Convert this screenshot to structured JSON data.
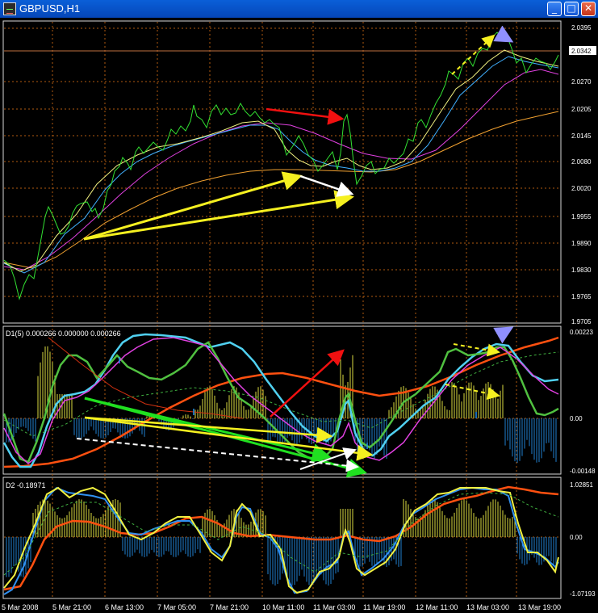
{
  "window": {
    "title": "GBPUSD,H1",
    "buttons": [
      "_",
      "□",
      "✕"
    ]
  },
  "price_scale": [
    "2.0395",
    "2.0342",
    "2.0270",
    "2.0205",
    "2.0145",
    "2.0080",
    "2.0020",
    "1.9955",
    "1.9890",
    "1.9830",
    "1.9765",
    "1.9705"
  ],
  "current_price": "2.0342",
  "panel1": {
    "label": "D1(5) 0.000266 0.000000 0.000266",
    "scale": [
      "0.00223",
      "0.00",
      "-0.00148"
    ]
  },
  "panel2": {
    "label": "D2 -0.18971",
    "scale": [
      "1.02851",
      "0.00",
      "-1.07193"
    ]
  },
  "time_axis": [
    "5 Mar 2008",
    "5 Mar 21:00",
    "6 Mar 13:00",
    "7 Mar 05:00",
    "7 Mar 21:00",
    "10 Mar 11:00",
    "11 Mar 03:00",
    "11 Mar 19:00",
    "12 Mar 11:00",
    "13 Mar 03:00",
    "13 Mar 19:00"
  ],
  "colors": {
    "background": "#000000",
    "grid": "#b05a10",
    "price": "#32e032",
    "ma_fast": "#f0f080",
    "ma_cyan": "#40b0ff",
    "ma_magenta": "#e040e0",
    "ma_slow": "#f0a030",
    "osc_cyan": "#50d0f0",
    "osc_green": "#50c040",
    "osc_red": "#ff5010",
    "hist_yellow": "#dada40",
    "hist_blue": "#2080d0"
  }
}
